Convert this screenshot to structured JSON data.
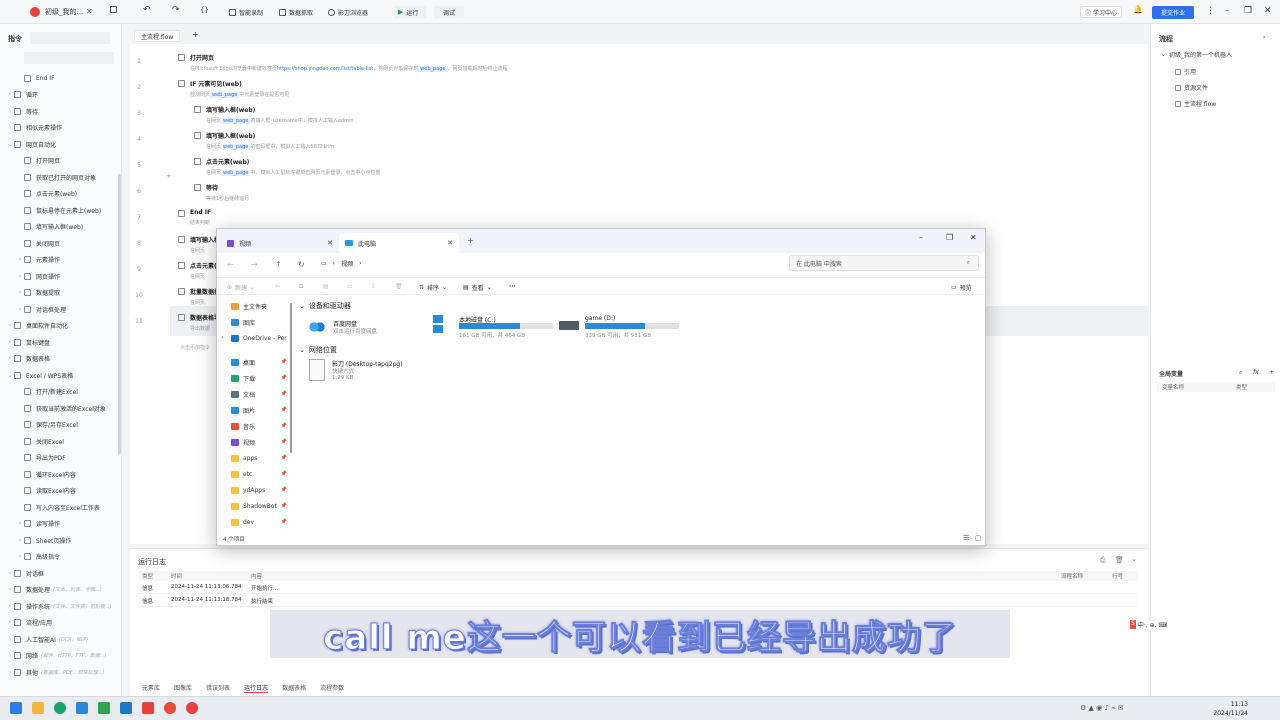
{
  "titlebar": {
    "app_name": "初级_我的...",
    "buttons": {
      "smart_record": "智能录制",
      "data_capture": "数据抓取",
      "shadow_browser": "影刀浏览器",
      "run": "运行",
      "debug": "调试"
    },
    "learn_center": "学习中心",
    "submit": "提交作业"
  },
  "left_panel": {
    "title": "指令",
    "items": [
      {
        "label": "End IF",
        "level": 2,
        "arrow": ""
      },
      {
        "label": "循环",
        "level": 1,
        "arrow": "›"
      },
      {
        "label": "等待",
        "level": 1,
        "arrow": "›"
      },
      {
        "label": "相似元素操作",
        "level": 1,
        "arrow": "›"
      },
      {
        "label": "网页自动化",
        "level": 1,
        "arrow": "⌄"
      },
      {
        "label": "打开网页",
        "level": 2,
        "arrow": ""
      },
      {
        "label": "获取已打开的网页对象",
        "level": 2,
        "arrow": ""
      },
      {
        "label": "点击元素(web)",
        "level": 2,
        "arrow": ""
      },
      {
        "label": "鼠标悬停在元素上(web)",
        "level": 2,
        "arrow": ""
      },
      {
        "label": "填写输入框(web)",
        "level": 2,
        "arrow": ""
      },
      {
        "label": "关闭网页",
        "level": 2,
        "arrow": ""
      },
      {
        "label": "元素操作",
        "level": 2,
        "arrow": "›"
      },
      {
        "label": "网页操作",
        "level": 2,
        "arrow": "›"
      },
      {
        "label": "数据提取",
        "level": 2,
        "arrow": "›"
      },
      {
        "label": "对话框处理",
        "level": 2,
        "arrow": "›"
      },
      {
        "label": "桌面软件自动化",
        "level": 1,
        "arrow": "›"
      },
      {
        "label": "鼠标键盘",
        "level": 1,
        "arrow": "›"
      },
      {
        "label": "数据表格",
        "level": 1,
        "arrow": "›"
      },
      {
        "label": "Excel / WPS表格",
        "level": 1,
        "arrow": "⌄"
      },
      {
        "label": "打开/新建Excel",
        "level": 2,
        "arrow": ""
      },
      {
        "label": "获取当前激活的Excel对象",
        "level": 2,
        "arrow": ""
      },
      {
        "label": "保存/另存Excel",
        "level": 2,
        "arrow": ""
      },
      {
        "label": "关闭Excel",
        "level": 2,
        "arrow": ""
      },
      {
        "label": "导出为PDF",
        "level": 2,
        "arrow": ""
      },
      {
        "label": "循环Excel内容",
        "level": 2,
        "arrow": ""
      },
      {
        "label": "读取Excel内容",
        "level": 2,
        "arrow": ""
      },
      {
        "label": "写入内容至Excel工作表",
        "level": 2,
        "arrow": ""
      },
      {
        "label": "读写操作",
        "level": 2,
        "arrow": "›"
      },
      {
        "label": "Sheet页操作",
        "level": 2,
        "arrow": "›"
      },
      {
        "label": "高级指令",
        "level": 2,
        "arrow": "›"
      },
      {
        "label": "对话框",
        "level": 1,
        "arrow": "›"
      },
      {
        "label": "数据处理",
        "level": 1,
        "arrow": "›",
        "sub": "(文本、列表、字典...)"
      },
      {
        "label": "操作系统",
        "level": 1,
        "arrow": "›",
        "sub": "(文件、文件夹、剪贴板...)"
      },
      {
        "label": "流程/应用",
        "level": 1,
        "arrow": "›"
      },
      {
        "label": "人工智能AI",
        "level": 1,
        "arrow": "›",
        "sub": "(OCR、NLP)"
      },
      {
        "label": "网络",
        "level": 1,
        "arrow": "›",
        "sub": "(邮件、HTTP、FTP、数据...)"
      },
      {
        "label": "其他",
        "level": 1,
        "arrow": "›",
        "sub": "(数据库、PDF、异常处理...)"
      }
    ]
  },
  "editor": {
    "tab": "主流程.flow",
    "add_tab": "+",
    "steps": [
      {
        "num": "1",
        "title": "打开网页",
        "desc_pre": "在Microsoft Edge浏览器中新建标签页",
        "desc_link": "https://shop.yingdao.com/list/table-list",
        "desc_mid": "，将网页对象保存到",
        "tag": "web_page",
        "desc_post": "，网页加载超时后终止流程"
      },
      {
        "num": "2",
        "title": "IF 元素可见(web)",
        "desc_pre": "检测网页",
        "tag": "web_page",
        "desc_post": "中元素登录在是否可见"
      },
      {
        "num": "3",
        "title": "填写输入框(web)",
        "desc_pre": "在网页",
        "tag": "web_page",
        "desc_post": "的输入框_username中，模拟人工输入admin"
      },
      {
        "num": "4",
        "title": "填写输入框(web)",
        "desc_pre": "在网页",
        "tag": "web_page",
        "desc_post": "的密码框中，模拟人工输入5872$hm"
      },
      {
        "num": "5",
        "title": "点击元素(web)",
        "desc_pre": "在网页",
        "tag": "web_page",
        "desc_post": "中，模拟人工鼠标左键单击网页元素登录，点击中心点位置"
      },
      {
        "num": "6",
        "title": "等待",
        "desc_pre": "等待1秒后继续运行",
        "tag": "",
        "desc_post": ""
      },
      {
        "num": "7",
        "title": "End IF",
        "desc_pre": "结束判断",
        "tag": "",
        "desc_post": ""
      },
      {
        "num": "8",
        "title": "填写输入框",
        "desc_pre": "在网页",
        "tag": "",
        "desc_post": ""
      },
      {
        "num": "9",
        "title": "点击元素(",
        "desc_pre": "在网页",
        "tag": "",
        "desc_post": ""
      },
      {
        "num": "10",
        "title": "批量数据抓",
        "desc_pre": "在网页",
        "tag": "",
        "desc_post": ""
      },
      {
        "num": "11",
        "title": "数据表格导",
        "desc_pre": "导出数据",
        "tag": "",
        "desc_post": ""
      }
    ],
    "add_hint": "点击添加指令"
  },
  "right_panel": {
    "title": "流程",
    "tree_root": "初级_我的第一个机器人",
    "tree_items": [
      "引用",
      "资源文件",
      "主流程.flow"
    ],
    "globals_title": "全局变量",
    "globals_cols": [
      "变量名称",
      "类型"
    ]
  },
  "runlog": {
    "title": "运行日志",
    "columns": [
      "类型",
      "时间",
      "内容",
      "流程名称",
      "行号"
    ],
    "rows": [
      {
        "type": "信息",
        "time": "2024-11-24 11:13:06.784",
        "content": "开始执行..."
      },
      {
        "type": "信息",
        "time": "2024-11-24 11:13:18.784",
        "content": "执行结束"
      }
    ],
    "bottom_tabs": [
      "元素库",
      "图像库",
      "错误列表",
      "运行日志",
      "数据表格",
      "流程参数"
    ],
    "active_tab": "运行日志"
  },
  "explorer": {
    "tabs": [
      {
        "label": "视频",
        "active": false
      },
      {
        "label": "此电脑",
        "active": true
      }
    ],
    "address": [
      "视频"
    ],
    "search_placeholder": "在 此电脑 中搜索",
    "toolbar": {
      "new": "新建",
      "sort": "排序",
      "view": "查看",
      "more": "···",
      "preview": "预览"
    },
    "nav": [
      {
        "label": "主文件夹",
        "icon": "home-icon"
      },
      {
        "label": "图库",
        "icon": "gallery-icon"
      },
      {
        "label": "OneDrive - Per",
        "icon": "cloud-icon"
      },
      {
        "label": "桌面",
        "icon": "desktop-icon"
      },
      {
        "label": "下载",
        "icon": "download-icon"
      },
      {
        "label": "文档",
        "icon": "document-icon"
      },
      {
        "label": "图片",
        "icon": "picture-icon"
      },
      {
        "label": "音乐",
        "icon": "music-icon"
      },
      {
        "label": "视频",
        "icon": "video-icon"
      },
      {
        "label": "apps",
        "icon": "folder-icon"
      },
      {
        "label": "etc",
        "icon": "folder-icon"
      },
      {
        "label": "ydApps",
        "icon": "folder-icon"
      },
      {
        "label": "ShadowBot",
        "icon": "folder-icon"
      },
      {
        "label": "dev",
        "icon": "folder-icon"
      }
    ],
    "devices_title": "设备和驱动器",
    "baidu": {
      "name": "百度网盘",
      "desc": "双击运行百度网盘"
    },
    "drives": [
      {
        "name": "本地磁盘 (C:)",
        "info": "161 GB 可用，共 464 GB",
        "used_fraction": 0.65
      },
      {
        "name": "game (D:)",
        "info": "339 GB 可用，共 931 GB",
        "used_fraction": 0.64
      }
    ],
    "network_title": "网络位置",
    "network_item": {
      "name": "影刀 (Desktop-tapq2pg)",
      "type": "快捷方式",
      "size": "1.29 KB"
    },
    "status": "4 个项目"
  },
  "subtitle": "call me这一个可以看到已经导出成功了",
  "ime": {
    "s": "S",
    "text": "中·, ⊕, ⌨"
  },
  "clock": {
    "time": "11:13",
    "date": "2024/11/24"
  },
  "colors": {
    "accent": "#2f6fed",
    "brand_red": "#e8413b",
    "drive_fill": "#2a8ad6"
  }
}
